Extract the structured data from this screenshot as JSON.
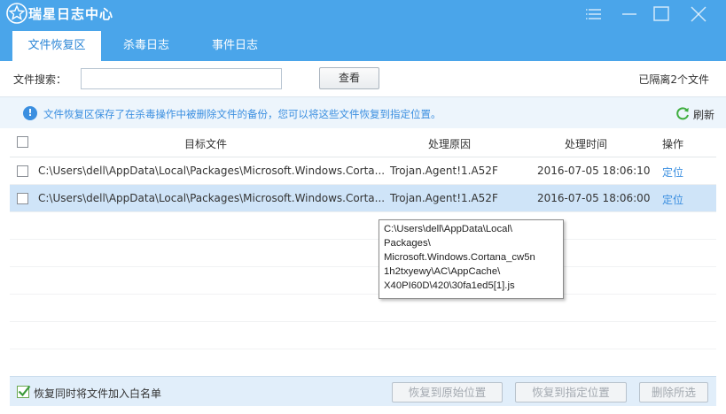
{
  "window": {
    "title": "瑞星日志中心",
    "logo_icon": "rising-lion-logo-icon",
    "controls": [
      "menu-icon",
      "minimize-icon",
      "maximize-icon",
      "close-icon"
    ],
    "colors": {
      "accent": "#4aa5ea",
      "link": "#3b8fe0",
      "selected_row": "#cfe4f8"
    }
  },
  "tabs": [
    {
      "label": "文件恢复区",
      "active": true
    },
    {
      "label": "杀毒日志",
      "active": false
    },
    {
      "label": "事件日志",
      "active": false
    }
  ],
  "search": {
    "label": "文件搜索：",
    "value": "",
    "placeholder": "",
    "button_label": "查看"
  },
  "isolated_count": "已隔离2个文件",
  "info": {
    "text": "文件恢复区保存了在杀毒操作中被删除文件的备份，您可以将这些文件恢复到指定位置。",
    "refresh_label": "刷新"
  },
  "table": {
    "headers": {
      "target_file": "目标文件",
      "reason": "处理原因",
      "time": "处理时间",
      "action": "操作"
    },
    "rows": [
      {
        "path": "C:\\Users\\dell\\AppData\\Local\\Packages\\Microsoft.Windows.Corta...",
        "reason": "Trojan.Agent!1.A52F",
        "time": "2016-07-05 18:06:10",
        "action": "定位",
        "selected": false,
        "checked": false
      },
      {
        "path": "C:\\Users\\dell\\AppData\\Local\\Packages\\Microsoft.Windows.Corta...",
        "reason": "Trojan.Agent!1.A52F",
        "time": "2016-07-05 18:06:00",
        "action": "定位",
        "selected": true,
        "checked": false
      }
    ]
  },
  "tooltip": {
    "lines": [
      "C:\\Users\\dell\\AppData\\Local\\",
      "Packages\\",
      "Microsoft.Windows.Cortana_cw5n",
      "1h2txyewy\\AC\\AppCache\\",
      "X40PI60D\\420\\30fa1ed5[1].js"
    ]
  },
  "footer": {
    "whitelist_label": "恢复同时将文件加入白名单",
    "whitelist_checked": true,
    "buttons": {
      "restore_original": "恢复到原始位置",
      "restore_specified": "恢复到指定位置",
      "delete_selected": "删除所选"
    }
  }
}
